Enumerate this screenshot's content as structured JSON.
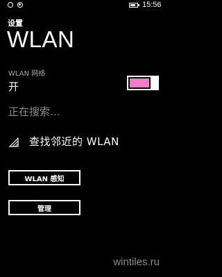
{
  "status_bar": {
    "time": "15:56",
    "left_icons": [
      "notification-dot-icon",
      "notification-dot-icon"
    ],
    "battery_icon": "battery-icon"
  },
  "header": {
    "app_title": "设置",
    "page_title": "WLAN"
  },
  "wlan": {
    "label": "WLAN 网络",
    "state": "开",
    "toggle_on": true
  },
  "search": {
    "status": "正在搜索…"
  },
  "find_nearby": {
    "icon": "wifi-signal-icon",
    "label": "查找邻近的 WLAN"
  },
  "buttons": {
    "sense": "WLAN 感知",
    "manage": "管理"
  },
  "watermark": "wintiles.ru",
  "colors": {
    "background": "#000000",
    "text": "#ffffff",
    "accent": "#f07cc8",
    "secondary_text": "#a8a8a8"
  }
}
